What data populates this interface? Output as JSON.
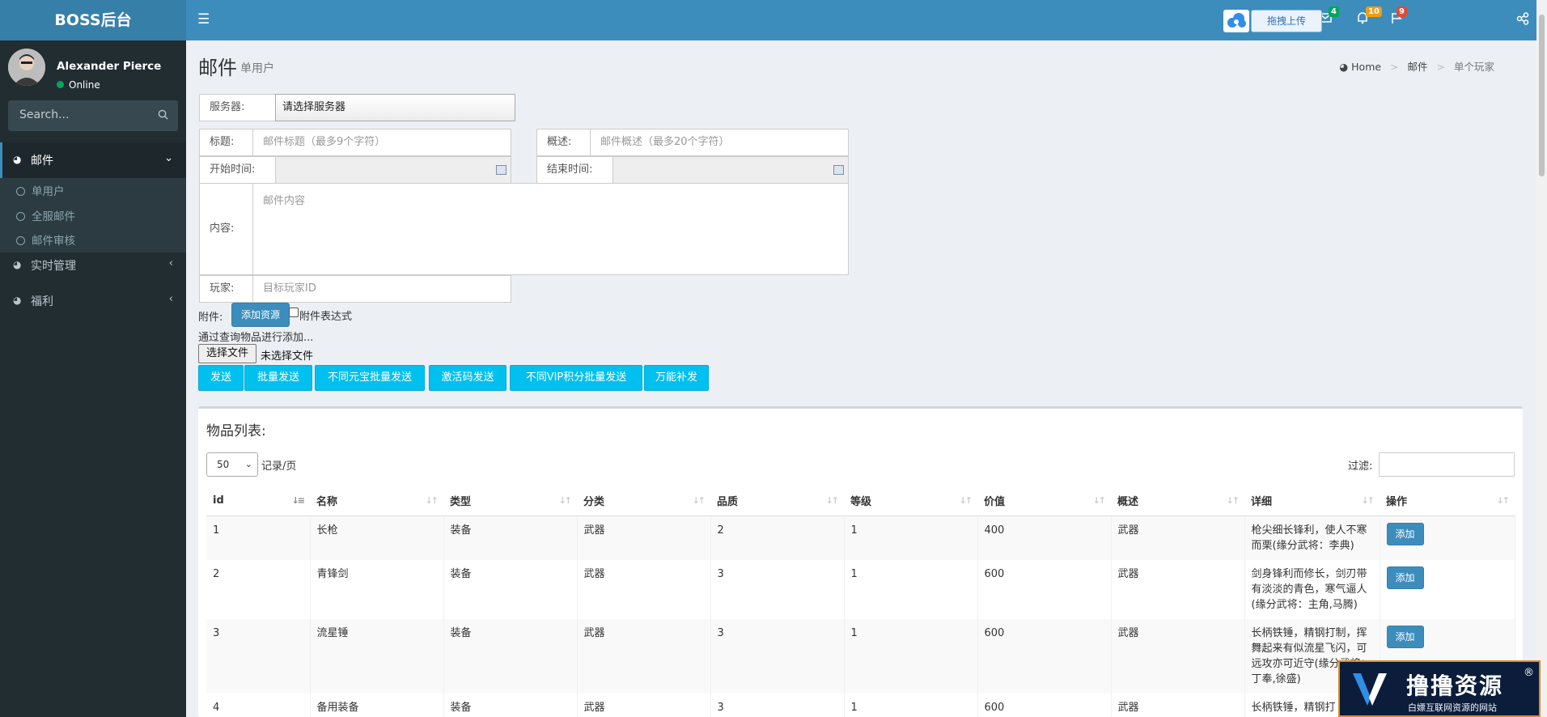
{
  "app": {
    "logo": "BOSS后台"
  },
  "navbar": {
    "mail_badge": "4",
    "bell_badge": "10",
    "flag_badge": "9",
    "upload_label": "拖拽上传",
    "colors": {
      "mail_badge": "#00a65a",
      "bell_badge": "#f39c12",
      "flag_badge": "#dd4b39"
    }
  },
  "sidebar": {
    "user_name": "Alexander Pierce",
    "user_status": "Online",
    "search_placeholder": "Search...",
    "menu": [
      {
        "label": "邮件",
        "icon": "pie-chart-icon",
        "expanded": true
      },
      {
        "label": "实时管理",
        "icon": "pie-chart-icon"
      },
      {
        "label": "福利",
        "icon": "pie-chart-icon"
      }
    ],
    "submenu": [
      "单用户",
      "全服邮件",
      "邮件审核"
    ]
  },
  "page": {
    "title": "邮件",
    "subtitle": "单用户"
  },
  "breadcrumb": {
    "home": "Home",
    "section": "邮件",
    "current": "单个玩家"
  },
  "form": {
    "server_label": "服务器:",
    "server_value": "请选择服务器",
    "title_label": "标题:",
    "title_placeholder": "邮件标题（最多9个字符）",
    "summary_label": "概述:",
    "summary_placeholder": "邮件概述（最多20个字符）",
    "start_label": "开始时间:",
    "end_label": "结束时间:",
    "content_label": "内容:",
    "content_placeholder": "邮件内容",
    "player_label": "玩家:",
    "player_placeholder": "目标玩家ID",
    "attach_label": "附件:",
    "add_resource": "添加资源",
    "attach_expr": "附件表达式",
    "query_text": "通过查询物品进行添加...",
    "file_button": "选择文件",
    "file_none": "未选择文件"
  },
  "actions": [
    "发送",
    "批量发送",
    "不同元宝批量发送",
    "激活码发送",
    "不同VIP积分批量发送",
    "万能补发"
  ],
  "items": {
    "title": "物品列表:",
    "page_size": "50",
    "page_size_label": "记录/页",
    "filter_label": "过滤:",
    "columns": [
      "id",
      "名称",
      "类型",
      "分类",
      "品质",
      "等级",
      "价值",
      "概述",
      "详细",
      "操作"
    ],
    "add_label": "添加",
    "rows": [
      {
        "id": "1",
        "name": "长枪",
        "type": "装备",
        "category": "武器",
        "quality": "2",
        "level": "1",
        "value": "400",
        "summary": "武器",
        "detail": "枪尖细长锋利，使人不寒而栗(缘分武将：李典)"
      },
      {
        "id": "2",
        "name": "青锋剑",
        "type": "装备",
        "category": "武器",
        "quality": "3",
        "level": "1",
        "value": "600",
        "summary": "武器",
        "detail": "剑身锋利而修长，剑刃带有淡淡的青色，寒气逼人(缘分武将：主角,马腾)"
      },
      {
        "id": "3",
        "name": "流星锤",
        "type": "装备",
        "category": "武器",
        "quality": "3",
        "level": "1",
        "value": "600",
        "summary": "武器",
        "detail": "长柄铁锤，精钢打制，挥舞起来有似流星飞闪，可远攻亦可近守(缘分武将：丁奉,徐盛)"
      },
      {
        "id": "4",
        "name": "备用装备",
        "type": "装备",
        "category": "武器",
        "quality": "3",
        "level": "1",
        "value": "600",
        "summary": "武器",
        "detail": "长柄铁锤，精钢打"
      }
    ]
  },
  "watermark": {
    "title": "撸撸资源",
    "mark": "®",
    "subtitle": "白嫖互联网资源的网站"
  }
}
